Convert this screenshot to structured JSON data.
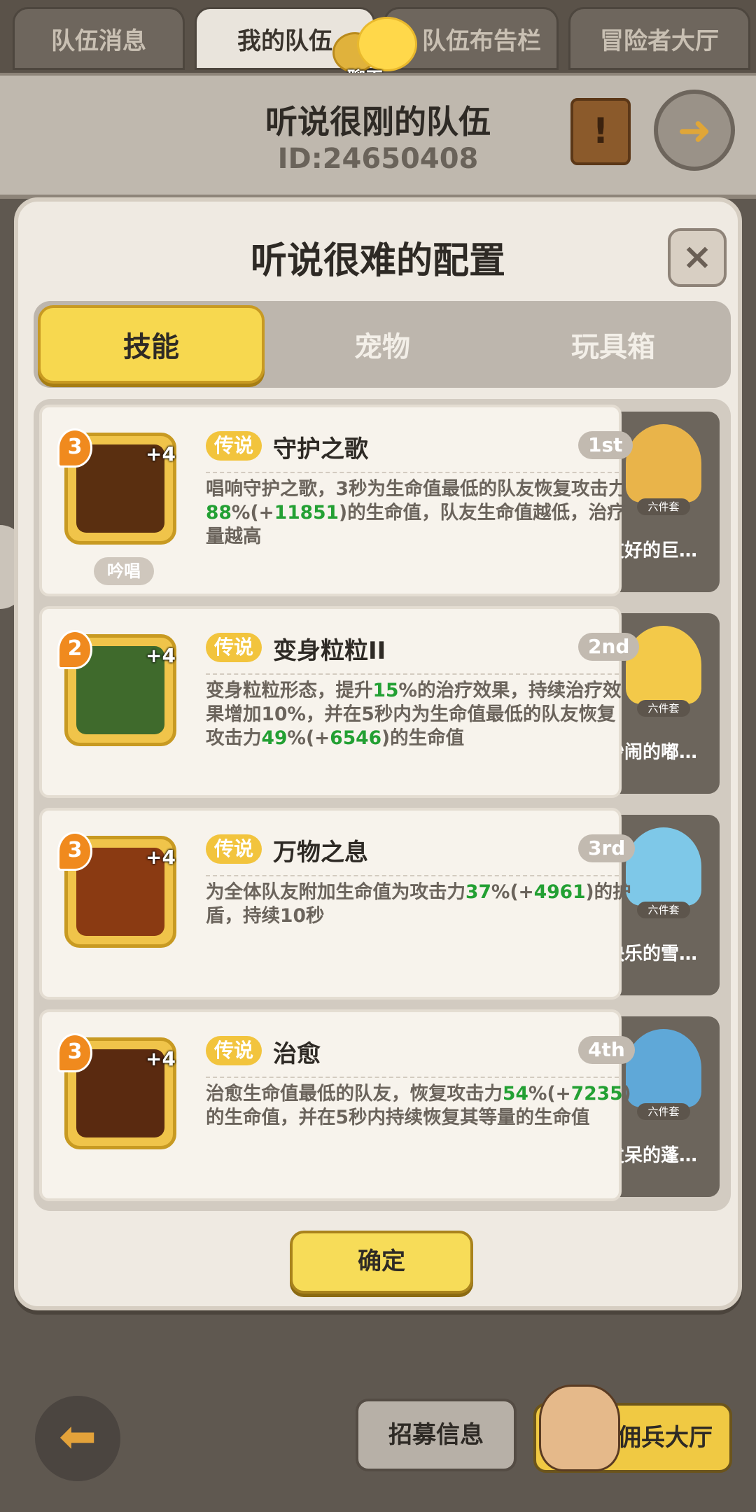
{
  "top_tabs": [
    "队伍消息",
    "我的队伍",
    "队伍布告栏",
    "冒险者大厅"
  ],
  "chat_label": "聊天",
  "team": {
    "name": "听说很刚的队伍",
    "id": "ID:24650408"
  },
  "modal": {
    "title": "听说很难的配置",
    "close": "×",
    "segments": [
      "技能",
      "宠物",
      "玩具箱"
    ],
    "confirm": "确定"
  },
  "skills": [
    {
      "level": "3",
      "bonus": "+4",
      "tag": "传说",
      "name": "守护之歌",
      "rank": "1st",
      "desc": [
        "唱响守护之歌，3秒为生命值最低的队友恢复攻击力",
        "88",
        "%(+",
        "11851",
        ")的生命值，队友生命值越低，治疗量越高"
      ],
      "chant": "吟唱",
      "pet": {
        "set": "六件套",
        "name": "友好的巨…"
      }
    },
    {
      "level": "2",
      "bonus": "+4",
      "tag": "传说",
      "name": "变身粒粒II",
      "rank": "2nd",
      "desc": [
        "变身粒粒形态，提升",
        "15",
        "%的治疗效果，持续治疗效果增加10%，并在5秒内为生命值最低的队友恢复攻击力",
        "49",
        "%(+",
        "6546",
        ")的生命值"
      ],
      "pet": {
        "set": "六件套",
        "name": "吵闹的嘟…"
      }
    },
    {
      "level": "3",
      "bonus": "+4",
      "tag": "传说",
      "name": "万物之息",
      "rank": "3rd",
      "desc": [
        "为全体队友附加生命值为攻击力",
        "37",
        "%(+",
        "4961",
        ")的护盾，持续10秒"
      ],
      "pet": {
        "set": "六件套",
        "name": "快乐的雪…"
      }
    },
    {
      "level": "3",
      "bonus": "+4",
      "tag": "传说",
      "name": "治愈",
      "rank": "4th",
      "desc": [
        "治愈生命值最低的队友，恢复攻击力",
        "54",
        "%(+",
        "7235",
        ")的生命值，并在5秒内持续恢复其等量的生命值"
      ],
      "pet": {
        "set": "六件套",
        "name": "发呆的蓬…"
      }
    }
  ],
  "bottom": {
    "recruit": "招募信息",
    "mercenary": "佣兵大厅"
  },
  "colors": {
    "accent_yellow": "#f7d84f",
    "value_green": "#23a033",
    "panel": "#efeae2"
  },
  "icons": [
    "chat-icon",
    "scroll-icon",
    "exit-icon",
    "close-icon",
    "back-arrow-icon"
  ]
}
